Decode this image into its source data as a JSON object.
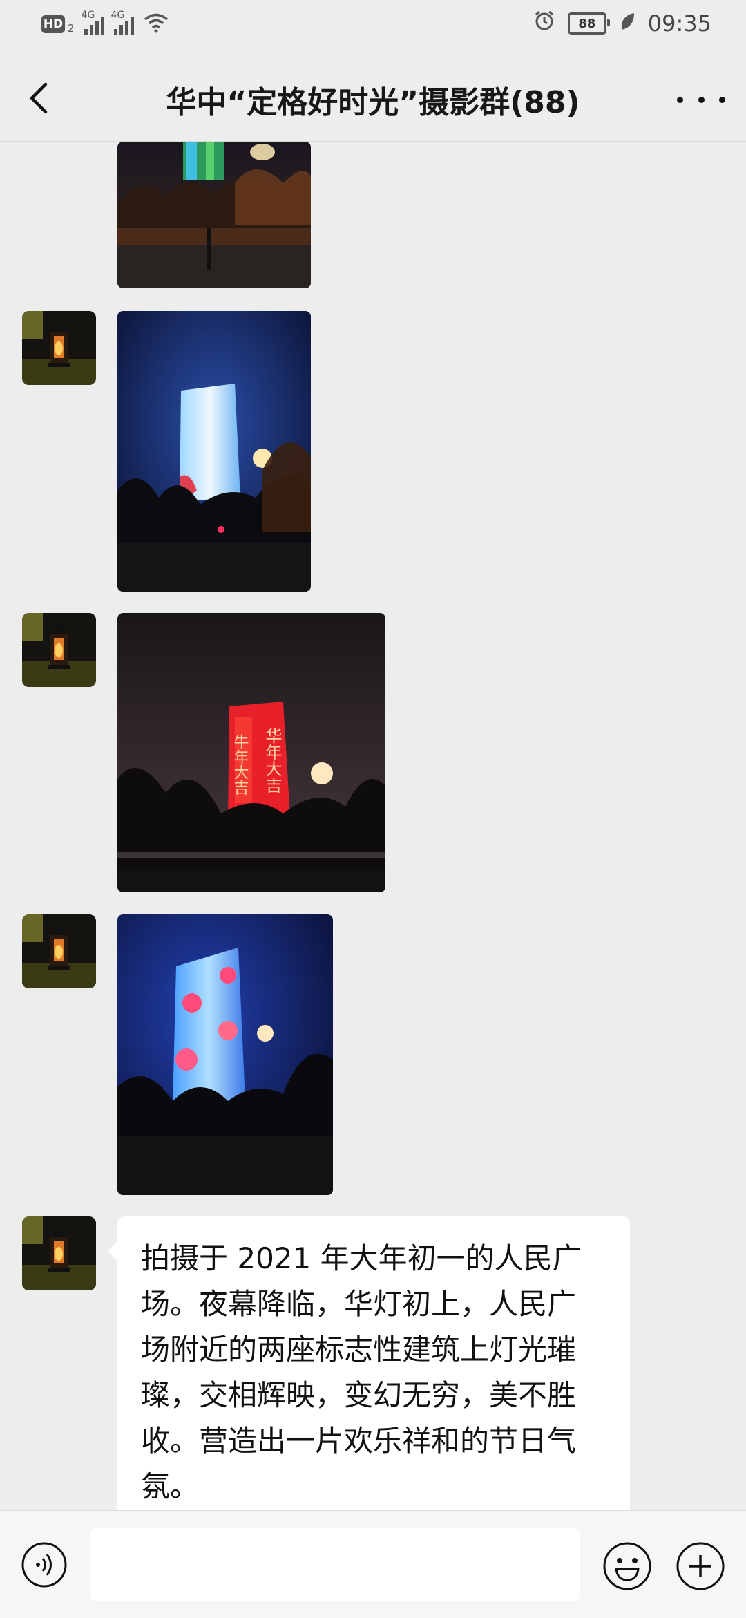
{
  "status_bar": {
    "hd_label": "HD",
    "hd_sub": "2",
    "signal1_label": "4G",
    "signal2_label": "4G",
    "battery_level": "88",
    "time": "09:35",
    "icons": [
      "wifi-icon",
      "alarm-icon",
      "leaf-icon"
    ]
  },
  "header": {
    "title": "华中“定格好时光”摄影群(88)",
    "back_icon": "chevron-left-icon",
    "more_icon": "more-dots-icon"
  },
  "messages": [
    {
      "type": "image",
      "sender_avatar": "lantern-avatar",
      "subject": "tower-green-lights"
    },
    {
      "type": "image",
      "sender_avatar": "lantern-avatar",
      "subject": "tower-white-blue-lights"
    },
    {
      "type": "image",
      "sender_avatar": "lantern-avatar",
      "subject": "tower-red-lights",
      "caption_on_building_left": "牛年大吉",
      "caption_on_building_right": "华年大吉"
    },
    {
      "type": "image",
      "sender_avatar": "lantern-avatar",
      "subject": "tower-blue-red-lights"
    },
    {
      "type": "text",
      "sender_avatar": "lantern-avatar",
      "lines": [
        "拍摄于 2021 年大年初一的人民广",
        "场。夜幕降临，华灯初上，人民广",
        "场附近的两座标志性建筑上灯光璀",
        "璨，交相辉映，变幻无穷，美不胜",
        "收。营造出一片欢乐祥和的节日气",
        "氛。"
      ]
    }
  ],
  "input_bar": {
    "voice_icon": "voice-icon",
    "input_value": "",
    "input_placeholder": "",
    "emoji_icon": "emoji-icon",
    "plus_icon": "plus-icon"
  }
}
